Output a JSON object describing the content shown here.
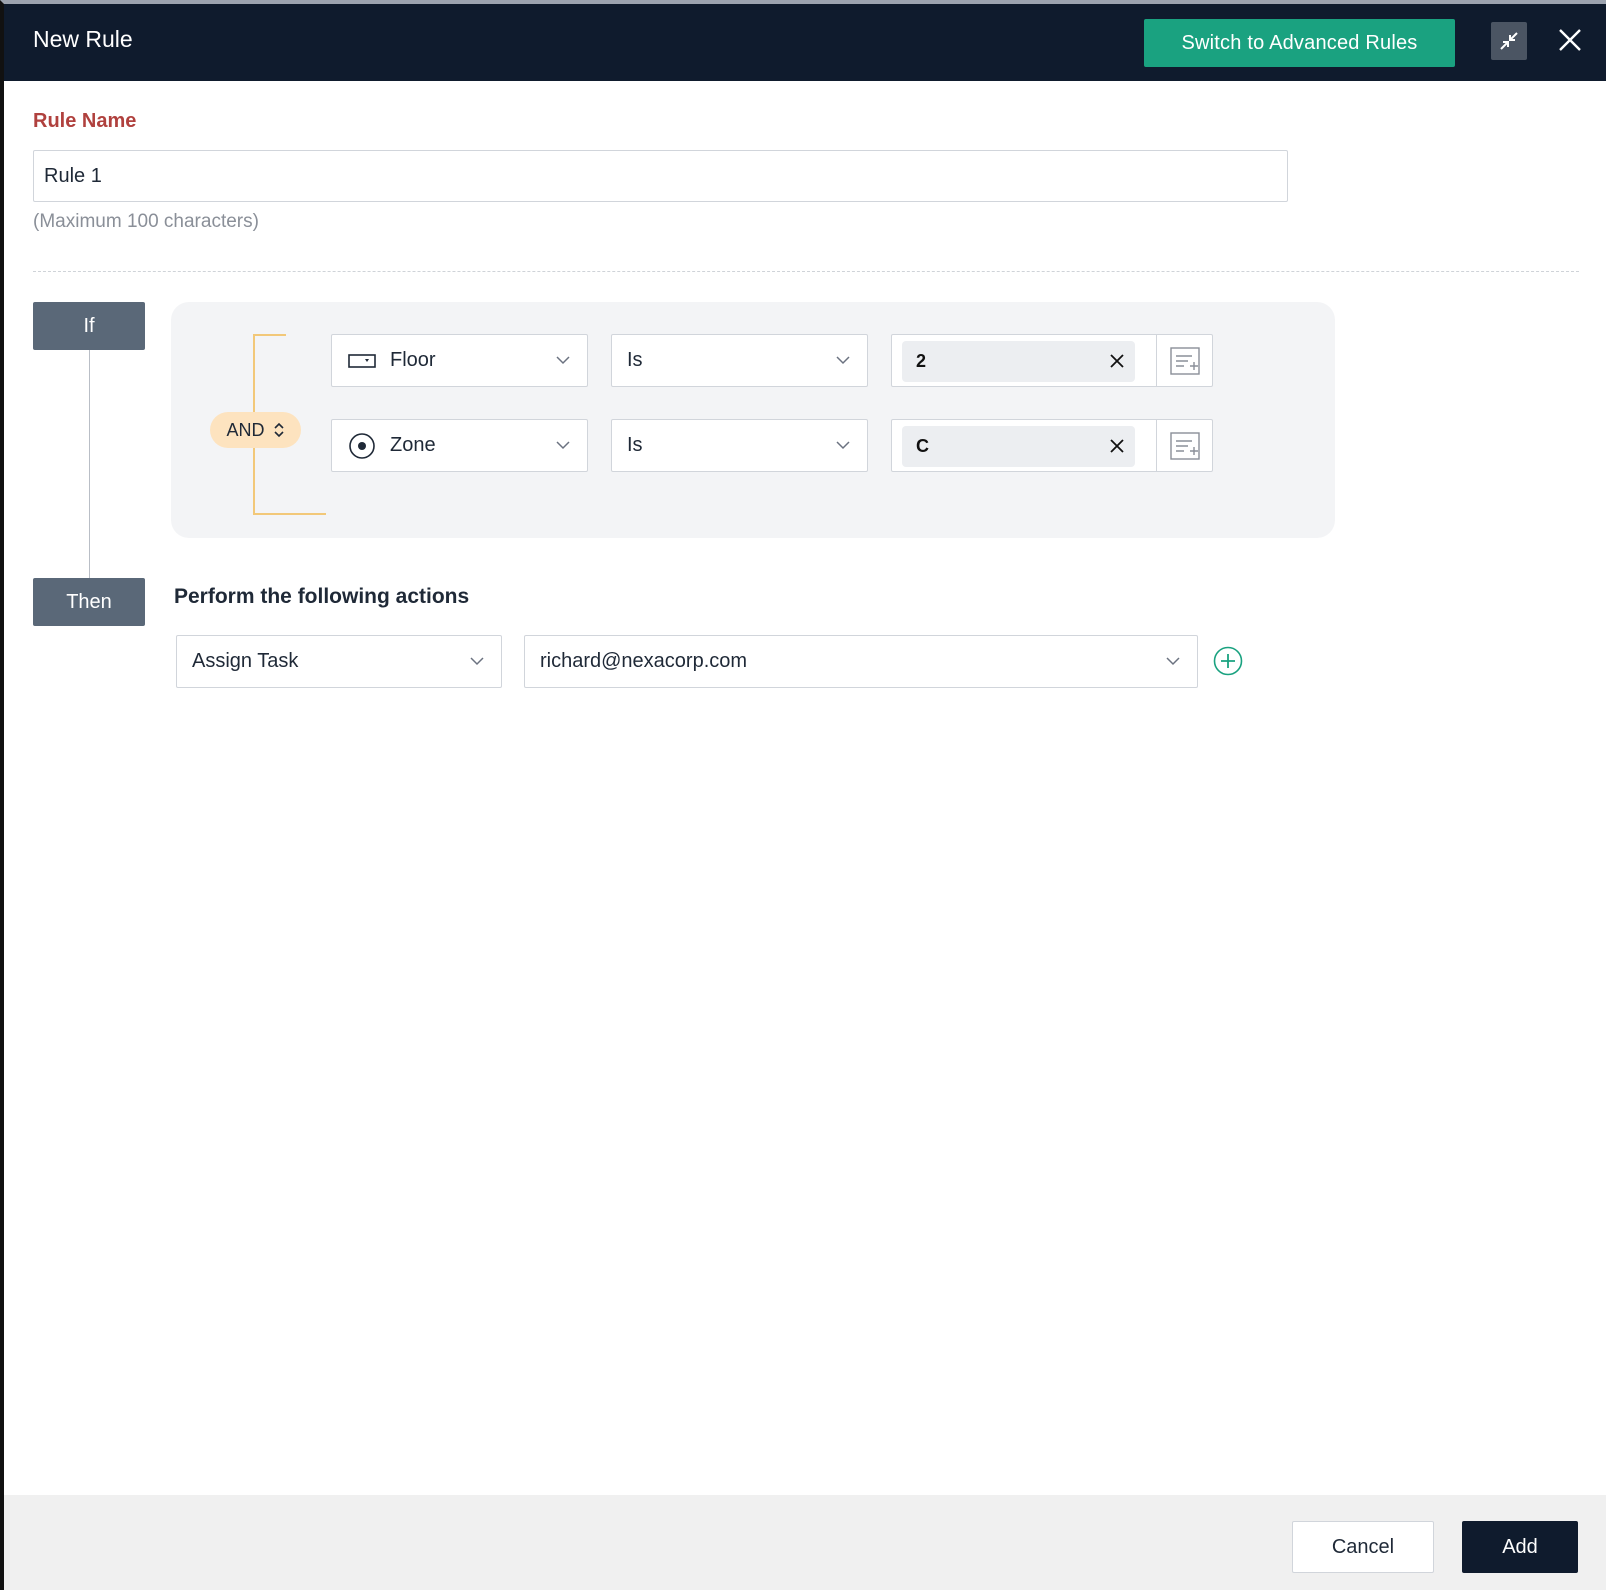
{
  "header": {
    "title": "New Rule",
    "switch_label": "Switch to Advanced Rules"
  },
  "rule_name": {
    "label": "Rule Name",
    "value": "Rule 1",
    "hint": "(Maximum 100 characters)"
  },
  "conditions": {
    "if_label": "If",
    "operator": "AND",
    "rows": [
      {
        "field": "Floor",
        "field_icon": "floor-icon",
        "comparator": "Is",
        "value": "2"
      },
      {
        "field": "Zone",
        "field_icon": "zone-icon",
        "comparator": "Is",
        "value": "C"
      }
    ]
  },
  "actions": {
    "then_label": "Then",
    "title": "Perform the following actions",
    "action_type": "Assign Task",
    "assignee": "richard@nexacorp.com"
  },
  "footer": {
    "cancel_label": "Cancel",
    "add_label": "Add"
  },
  "colors": {
    "header_bg": "#0f1b2d",
    "accent_green": "#1aa280",
    "rule_label_red": "#b0413e",
    "tag_bg": "#5a6878",
    "and_pill_bg": "#fde3bf",
    "bracket": "#f2c879"
  }
}
